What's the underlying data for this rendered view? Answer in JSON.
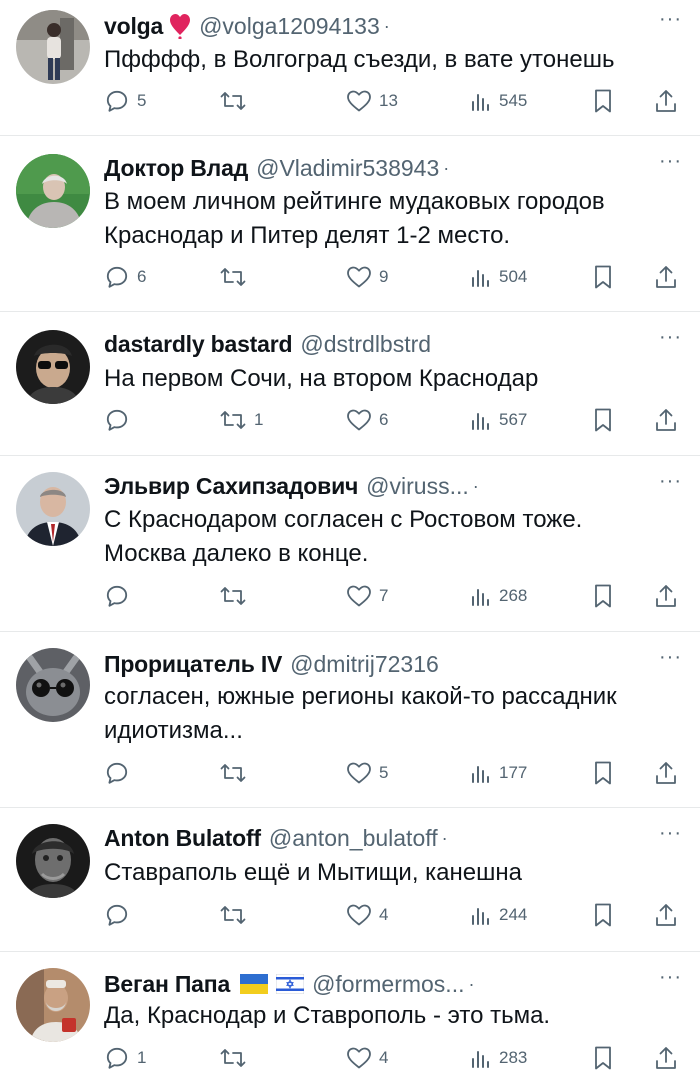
{
  "tweets": [
    {
      "name": "volga",
      "handle": "@volga12094133",
      "dot": "·",
      "more": "···",
      "lines": [
        "Пфффф, в Волгоград съезди, в вате утонешь"
      ],
      "reply": "5",
      "retweet": "",
      "like": "13",
      "views": "545"
    },
    {
      "name": "Доктор Влад",
      "handle": "@Vladimir538943",
      "dot": "·",
      "more": "···",
      "lines": [
        "В моем личном рейтинге мудаковых городов",
        "Краснодар и Питер делят 1-2 место."
      ],
      "reply": "6",
      "retweet": "",
      "like": "9",
      "views": "504"
    },
    {
      "name": "dastardly bastard",
      "handle": "@dstrdlbstrd",
      "dot": "",
      "more": "···",
      "lines": [
        "На первом Сочи, на втором Краснодар"
      ],
      "reply": "",
      "retweet": "1",
      "like": "6",
      "views": "567"
    },
    {
      "name": "Эльвир Сахипзадович",
      "handle": "@viruss...",
      "dot": "·",
      "more": "···",
      "lines": [
        "С Краснодаром согласен с Ростовом тоже.",
        "Москва далеко в конце."
      ],
      "reply": "",
      "retweet": "",
      "like": "7",
      "views": "268"
    },
    {
      "name": "Прорицатель IV",
      "handle": "@dmitrij72316",
      "dot": "",
      "more": "···",
      "lines": [
        "согласен, южные регионы какой-то рассадник",
        "идиотизма..."
      ],
      "reply": "",
      "retweet": "",
      "like": "5",
      "views": "177"
    },
    {
      "name": "Anton Bulatoff",
      "handle": "@anton_bulatoff",
      "dot": "·",
      "more": "···",
      "lines": [
        "Ставраполь ещё и Мытищи, канешна"
      ],
      "reply": "",
      "retweet": "",
      "like": "4",
      "views": "244"
    },
    {
      "name": "Веган Папа",
      "handle": "@formermos...",
      "dot": "·",
      "more": "···",
      "lines": [
        "Да, Краснодар и Ставрополь - это тьма."
      ],
      "reply": "1",
      "retweet": "",
      "like": "4",
      "views": "283"
    }
  ],
  "colors": {
    "text": "#0f1419",
    "secondary": "#536471",
    "divider": "#e7e9ea",
    "heart_emoji": "#e0245e"
  },
  "icons": {
    "reply": "reply-icon",
    "retweet": "retweet-icon",
    "like": "like-icon",
    "views": "views-icon",
    "bookmark": "bookmark-icon",
    "share": "share-icon",
    "more": "more-icon",
    "heart_emoji": "red-heart-emoji-icon",
    "flag_ua": "ukraine-flag-icon",
    "flag_il": "israel-flag-icon"
  }
}
